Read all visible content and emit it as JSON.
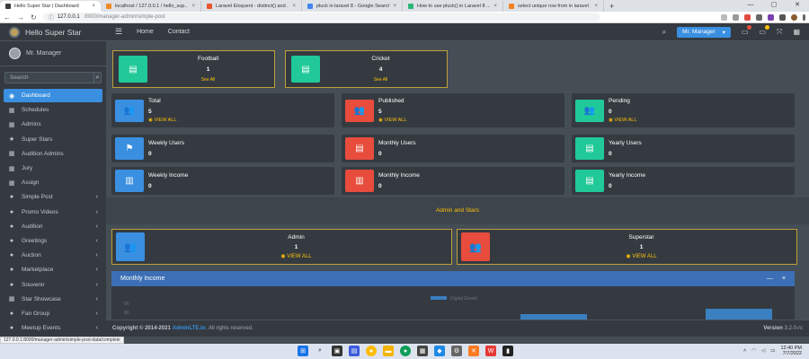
{
  "browser": {
    "tabs": [
      {
        "title": "Hello Super Star | Dashboard",
        "active": true,
        "color": "#3a3a3a"
      },
      {
        "title": "localhost / 127.0.0.1 / hello_sup...",
        "active": false,
        "color": "#f08a24"
      },
      {
        "title": "Laravel Eloquent - distinct() and ...",
        "active": false,
        "color": "#e8542c"
      },
      {
        "title": "pluck in laravel 8 - Google Search",
        "active": false,
        "color": "#4285f4"
      },
      {
        "title": "How to use pluck() in Laravel 8 ...",
        "active": false,
        "color": "#2bb673"
      },
      {
        "title": "select unique row from in laravel ...",
        "active": false,
        "color": "#f48024"
      }
    ],
    "url_host": "127.0.0.1",
    "url_path": ":8000/manager-admin/simple-post",
    "status_url": "127.0.0.1:8000/manager-admin/simple-post-data/complete"
  },
  "brand": {
    "name": "Hello Super Star"
  },
  "user": {
    "name": "Mr. Manager"
  },
  "search": {
    "placeholder": "Search"
  },
  "sidebar": {
    "items": [
      {
        "label": "Dashboard",
        "icon": "dashboard-icon",
        "glyph": "◉",
        "active": true,
        "arrow": false
      },
      {
        "label": "Schedules",
        "icon": "table-icon",
        "glyph": "▦",
        "active": false,
        "arrow": false
      },
      {
        "label": "Admins",
        "icon": "table-icon",
        "glyph": "▦",
        "active": false,
        "arrow": false
      },
      {
        "label": "Super Stars",
        "icon": "star-icon",
        "glyph": "★",
        "active": false,
        "arrow": false
      },
      {
        "label": "Audition Admins",
        "icon": "table-icon",
        "glyph": "▦",
        "active": false,
        "arrow": false
      },
      {
        "label": "Jury",
        "icon": "table-icon",
        "glyph": "▦",
        "active": false,
        "arrow": false
      },
      {
        "label": "Assign",
        "icon": "table-icon",
        "glyph": "▦",
        "active": false,
        "arrow": false
      },
      {
        "label": "Simple Post",
        "icon": "palette-icon",
        "glyph": "●",
        "active": false,
        "arrow": true
      },
      {
        "label": "Promo Videos",
        "icon": "palette-icon",
        "glyph": "●",
        "active": false,
        "arrow": true
      },
      {
        "label": "Audition",
        "icon": "palette-icon",
        "glyph": "●",
        "active": false,
        "arrow": true
      },
      {
        "label": "Greetings",
        "icon": "palette-icon",
        "glyph": "●",
        "active": false,
        "arrow": true
      },
      {
        "label": "Auction",
        "icon": "palette-icon",
        "glyph": "●",
        "active": false,
        "arrow": true
      },
      {
        "label": "Marketplace",
        "icon": "palette-icon",
        "glyph": "●",
        "active": false,
        "arrow": true
      },
      {
        "label": "Souvenir",
        "icon": "palette-icon",
        "glyph": "●",
        "active": false,
        "arrow": true
      },
      {
        "label": "Star Showcase",
        "icon": "table-icon",
        "glyph": "▦",
        "active": false,
        "arrow": true
      },
      {
        "label": "Fan Group",
        "icon": "palette-icon",
        "glyph": "●",
        "active": false,
        "arrow": true
      },
      {
        "label": "Meetup Events",
        "icon": "palette-icon",
        "glyph": "●",
        "active": false,
        "arrow": true
      }
    ]
  },
  "topnav": {
    "home": "Home",
    "contact": "Contact",
    "manager_button": "Mr. Manager"
  },
  "sports": [
    {
      "name": "Football",
      "count": "1",
      "link": "See All",
      "icon": "list-icon"
    },
    {
      "name": "Cricket",
      "count": "4",
      "link": "See All",
      "icon": "list-icon"
    }
  ],
  "info_boxes": [
    {
      "title": "Total",
      "value": "5",
      "link": "VIEW ALL",
      "icon": "users-icon",
      "glyph": "👥",
      "color": "#3a8fe0"
    },
    {
      "title": "Published",
      "value": "5",
      "link": "VIEW ALL",
      "icon": "users-icon",
      "glyph": "👥",
      "color": "#e74c3c"
    },
    {
      "title": "Pending",
      "value": "0",
      "link": "VIEW ALL",
      "icon": "users-icon",
      "glyph": "👥",
      "color": "#20c997"
    },
    {
      "title": "Weekly Users",
      "value": "0",
      "link": "",
      "icon": "flag-icon",
      "glyph": "⚑",
      "color": "#3a8fe0"
    },
    {
      "title": "Monthly Users",
      "value": "0",
      "link": "",
      "icon": "map-icon",
      "glyph": "▤",
      "color": "#e74c3c"
    },
    {
      "title": "Yearly Users",
      "value": "0",
      "link": "",
      "icon": "map-icon",
      "glyph": "▤",
      "color": "#20c997"
    },
    {
      "title": "Weekly Income",
      "value": "0",
      "link": "",
      "icon": "chart-icon",
      "glyph": "▥",
      "color": "#3a8fe0"
    },
    {
      "title": "Monthly Income",
      "value": "0",
      "link": "",
      "icon": "chart-icon",
      "glyph": "▥",
      "color": "#e74c3c"
    },
    {
      "title": "Yearly Income",
      "value": "0",
      "link": "",
      "icon": "document-icon",
      "glyph": "▤",
      "color": "#20c997"
    }
  ],
  "section_title": "Admin and Stars",
  "wide_boxes": [
    {
      "title": "Admin",
      "value": "1",
      "link": "VIEW ALL",
      "icon": "users-icon",
      "color": "#3a8fe0"
    },
    {
      "title": "Superstar",
      "value": "1",
      "link": "VIEW ALL",
      "icon": "users-icon",
      "color": "#e74c3c"
    }
  ],
  "monthly_card": {
    "title": "Monthly Income",
    "min_label": "—",
    "close_label": "×"
  },
  "chart_data": {
    "type": "bar",
    "legend": "Digital Goods",
    "yticks": [
      "90",
      "80"
    ],
    "bars_visible": [
      {
        "index": 0,
        "value": 85
      },
      {
        "index": 1,
        "value": 88
      }
    ]
  },
  "footer": {
    "copyright": "Copyright © 2014-2021",
    "brand": "AdminLTE.io.",
    "rights": "All rights reserved.",
    "version_label": "Version",
    "version": "3.2.0-rc"
  },
  "taskbar": {
    "time": "12:40 PM",
    "date": "7/7/2022"
  }
}
